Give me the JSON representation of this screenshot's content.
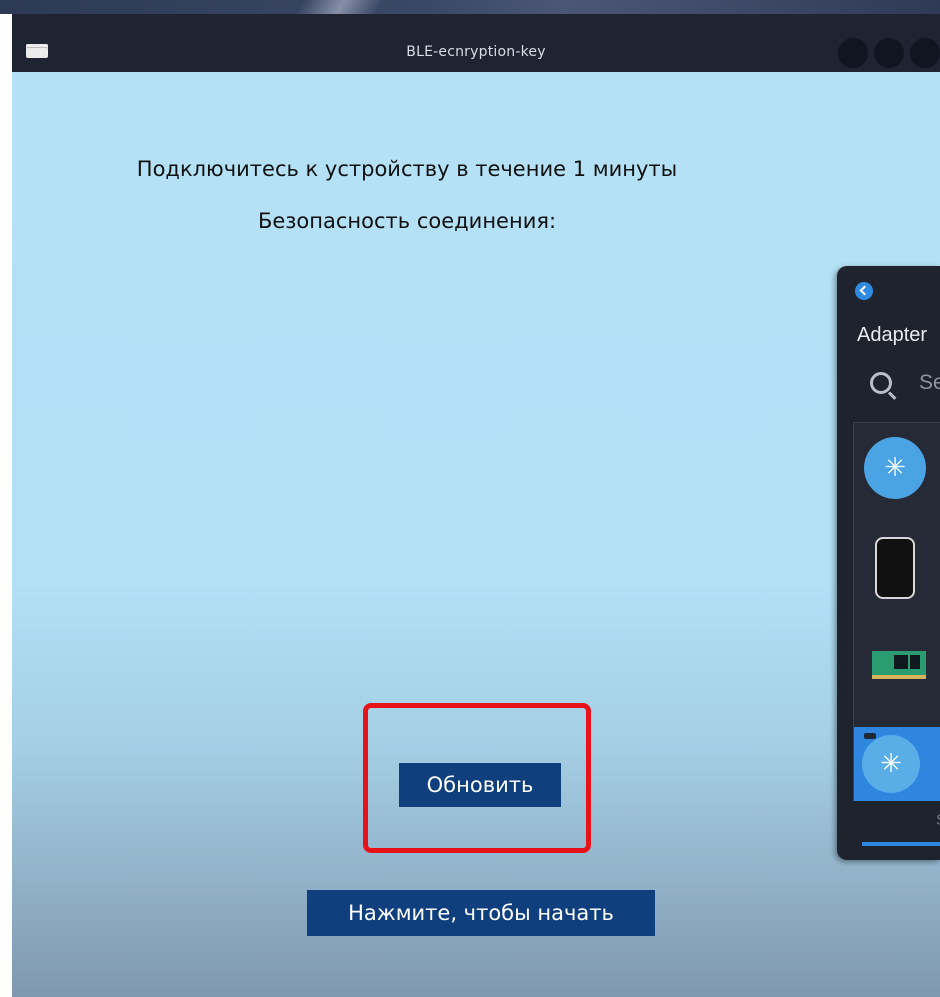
{
  "window": {
    "title": "BLE-ecnryption-key"
  },
  "main": {
    "connect_prompt": "Подключитесь к устройству в течение 1 минуты",
    "security_label": "Безопасность соединения:",
    "refresh_button": "Обновить",
    "start_button": "Нажмите, чтобы начать"
  },
  "highlight": {
    "color": "#e6131a"
  },
  "bluetooth_panel": {
    "title": "Adapter",
    "search_placeholder": "Se",
    "tab_label": "S",
    "items": [
      {
        "icon": "bluetooth-icon"
      },
      {
        "icon": "phone-icon"
      },
      {
        "icon": "sound-card-icon"
      },
      {
        "icon": "bluetooth-icon",
        "selected": true
      }
    ]
  },
  "colors": {
    "button_bg": "#0f3f7c",
    "content_bg": "#b5e1f6",
    "accent_blue": "#2e86de"
  }
}
